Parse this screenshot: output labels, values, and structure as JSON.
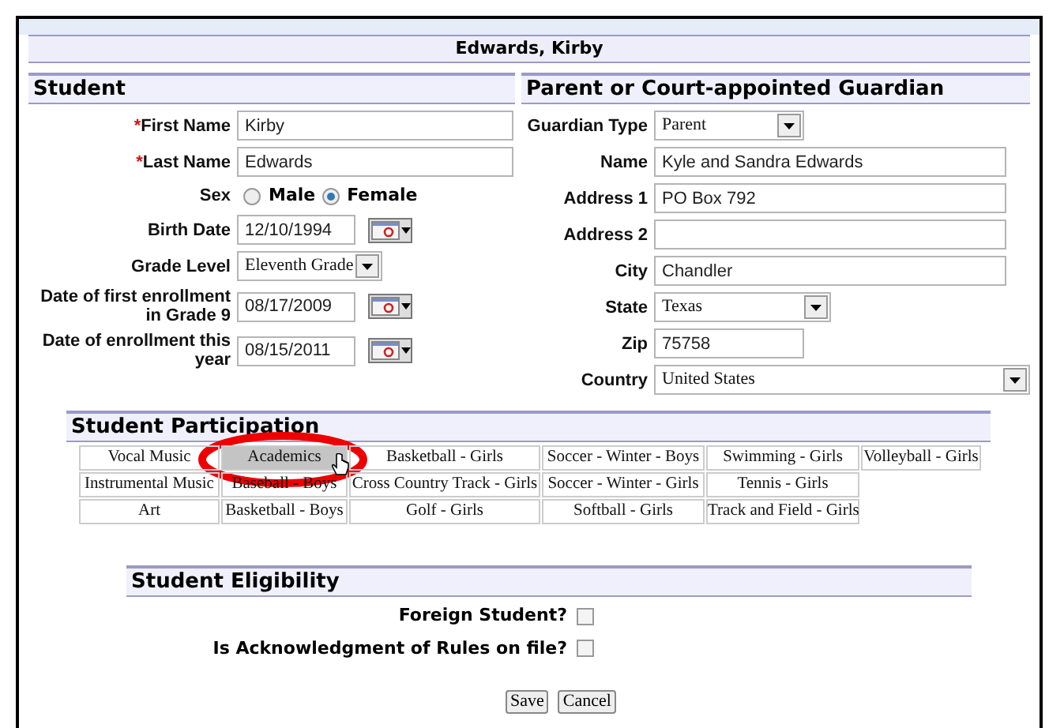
{
  "title": "Edwards, Kirby",
  "student": {
    "heading": "Student",
    "first_name": {
      "required_mark": "*",
      "label": "First Name",
      "value": "Kirby"
    },
    "last_name": {
      "required_mark": "*",
      "label": "Last Name",
      "value": "Edwards"
    },
    "sex": {
      "label": "Sex",
      "options": [
        {
          "label": "Male",
          "selected": false
        },
        {
          "label": "Female",
          "selected": true
        }
      ]
    },
    "birth_date": {
      "label": "Birth Date",
      "value": "12/10/1994"
    },
    "grade_level": {
      "label": "Grade Level",
      "value": "Eleventh Grade"
    },
    "first_enrollment": {
      "label": "Date of first enrollment in Grade 9",
      "value": "08/17/2009"
    },
    "enrollment_this_year": {
      "label": "Date of enrollment this year",
      "value": "08/15/2011"
    }
  },
  "guardian": {
    "heading": "Parent or Court-appointed Guardian",
    "fields": [
      {
        "kind": "select",
        "label": "Guardian Type",
        "value": "Parent"
      },
      {
        "kind": "text",
        "label": "Name",
        "value": "Kyle and Sandra Edwards"
      },
      {
        "kind": "text",
        "label": "Address 1",
        "value": "PO Box 792"
      },
      {
        "kind": "text",
        "label": "Address 2"
      },
      {
        "kind": "text",
        "label": "City",
        "value": "Chandler"
      },
      {
        "kind": "select",
        "label": "State",
        "value": "Texas"
      },
      {
        "kind": "text",
        "label": "Zip",
        "value": "75758"
      },
      {
        "kind": "select",
        "label": "Country",
        "value": "United States"
      }
    ]
  },
  "participation": {
    "heading": "Student Participation",
    "rows": [
      [
        {
          "label": "Vocal Music",
          "selected": false
        },
        {
          "label": "Academics",
          "selected": true
        },
        {
          "label": "Basketball - Girls",
          "selected": false
        },
        {
          "label": "Soccer - Winter - Boys",
          "selected": false
        },
        {
          "label": "Swimming - Girls",
          "selected": false
        },
        {
          "label": "Volleyball - Girls",
          "selected": false
        }
      ],
      [
        {
          "label": "Instrumental Music",
          "selected": false
        },
        {
          "label": "Baseball - Boys",
          "selected": false
        },
        {
          "label": "Cross Country Track - Girls",
          "selected": false
        },
        {
          "label": "Soccer - Winter - Girls",
          "selected": false
        },
        {
          "label": "Tennis - Girls",
          "selected": false
        }
      ],
      [
        {
          "label": "Art",
          "selected": false
        },
        {
          "label": "Basketball - Boys",
          "selected": false
        },
        {
          "label": "Golf - Girls",
          "selected": false
        },
        {
          "label": "Softball - Girls",
          "selected": false
        },
        {
          "label": "Track and Field - Girls",
          "selected": false
        }
      ]
    ]
  },
  "eligibility": {
    "heading": "Student Eligibility",
    "items": [
      {
        "label": "Foreign Student?",
        "checked": false
      },
      {
        "label": "Is Acknowledgment of Rules on file?",
        "checked": false
      }
    ]
  },
  "buttons": [
    "Save",
    "Cancel"
  ]
}
